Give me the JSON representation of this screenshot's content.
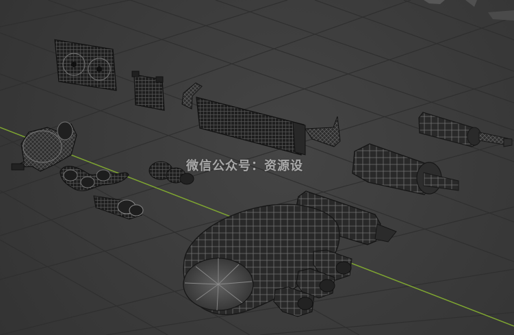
{
  "viewport": {
    "background": "#3b3b3b",
    "grid_color": "#2f2f2f",
    "x_axis_color": "#7fa631"
  },
  "watermark": {
    "text": "微信公众号：资源设"
  }
}
